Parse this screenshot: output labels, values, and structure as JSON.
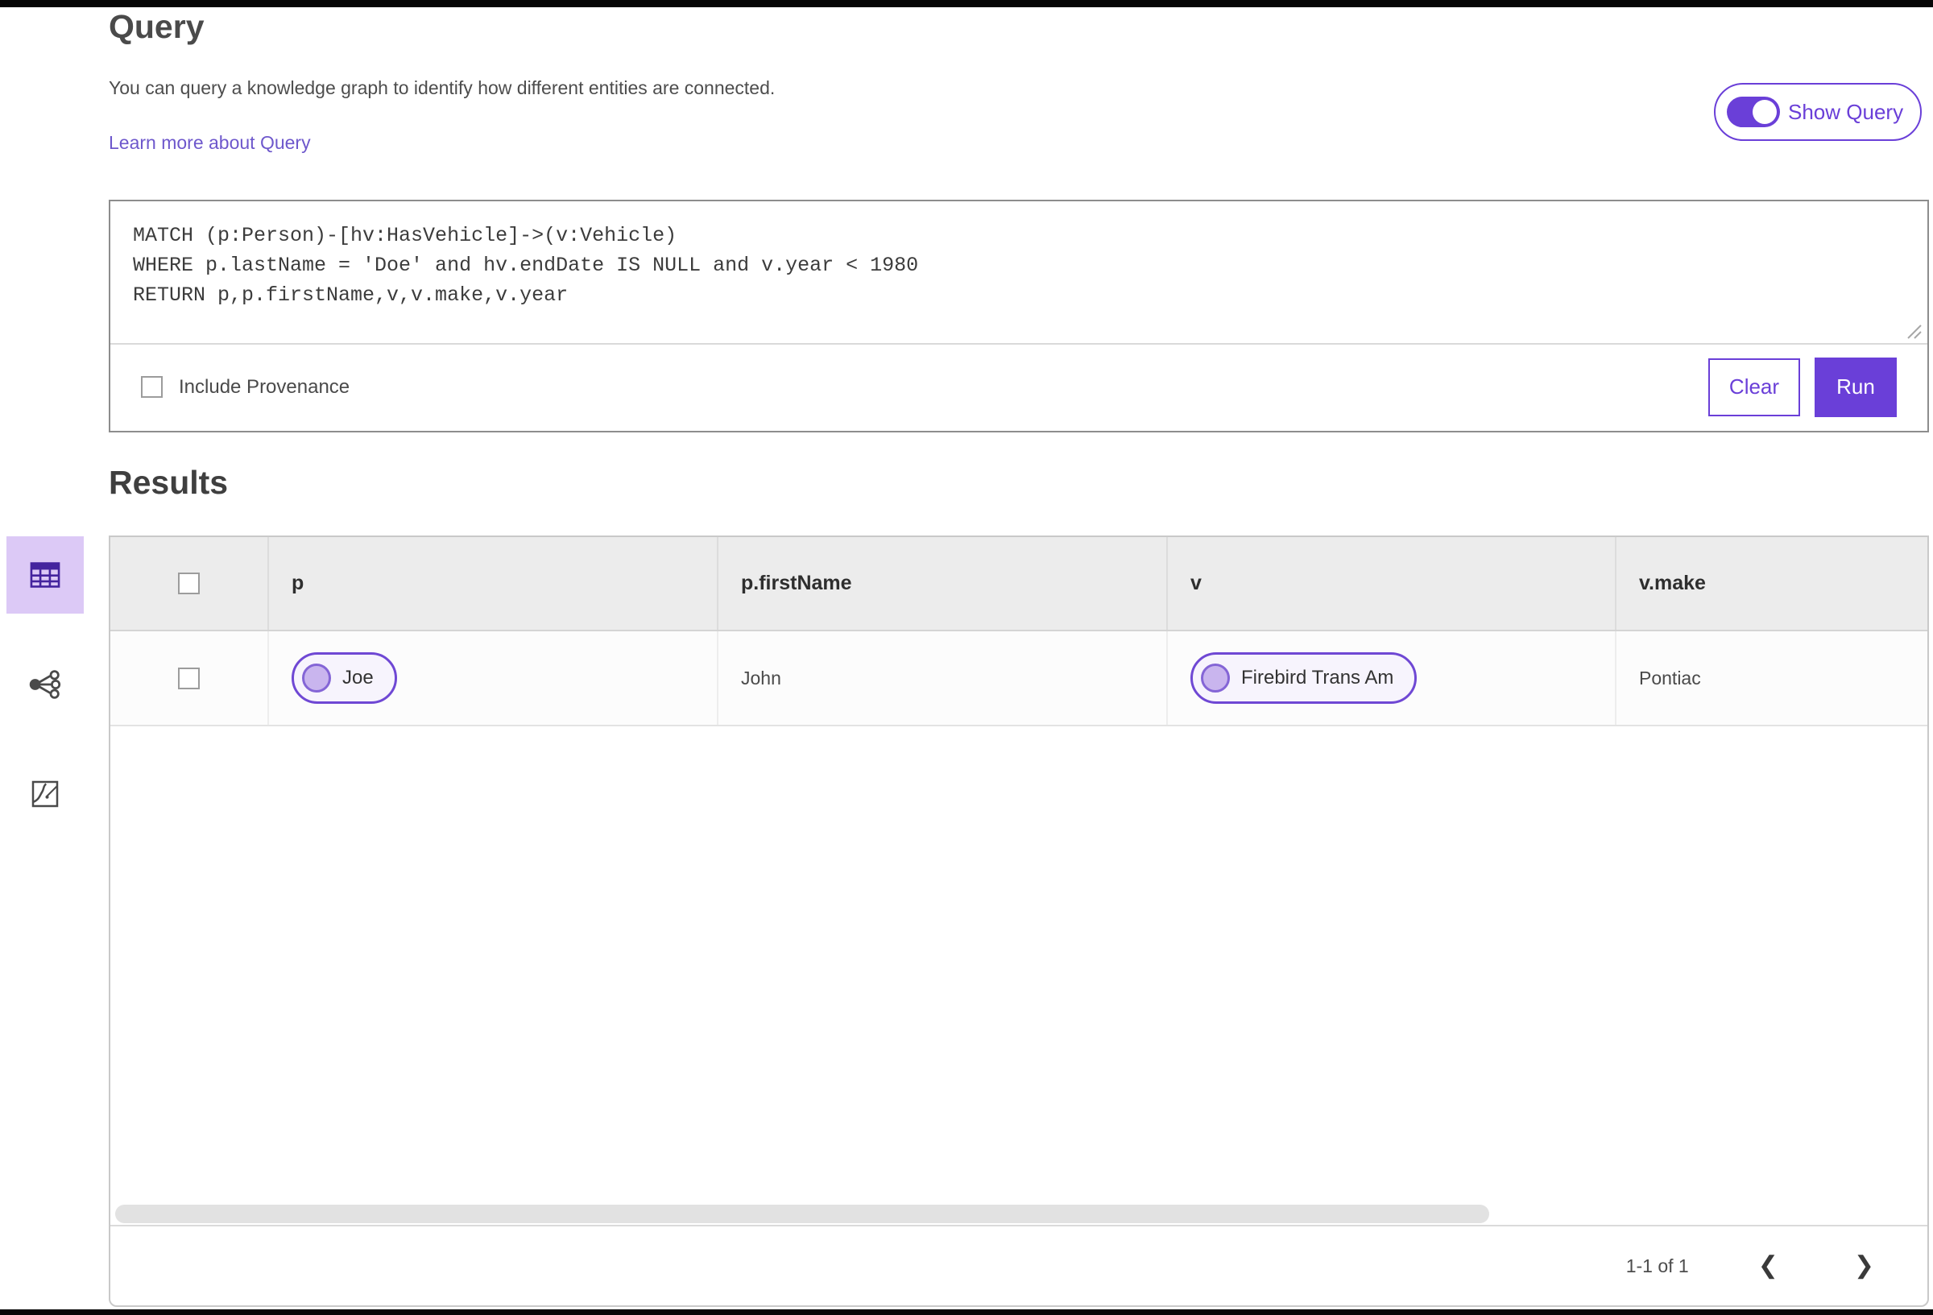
{
  "colors": {
    "accent_purple": "#6a3fd8",
    "link_purple": "#6e58cc",
    "selected_tile": "#dcc9f6",
    "chip_bg": "#f7f4fd",
    "chip_border": "#6f48d4",
    "table_header_bg": "#ececec"
  },
  "header": {
    "title": "Query",
    "description": "You can query a knowledge graph to identify how different entities are connected.",
    "learn_more": "Learn more about Query",
    "show_query_label": "Show Query",
    "show_query_on": true
  },
  "query_editor": {
    "code_lines": [
      "MATCH (p:Person)-[hv:HasVehicle]->(v:Vehicle)",
      "WHERE p.lastName = 'Doe' and hv.endDate IS NULL and v.year < 1980",
      "RETURN p,p.firstName,v,v.make,v.year"
    ],
    "include_provenance_label": "Include Provenance",
    "include_provenance_checked": false,
    "clear_label": "Clear",
    "run_label": "Run"
  },
  "results": {
    "title": "Results",
    "view_modes": [
      "table-view",
      "link-chart-view",
      "map-view"
    ],
    "selected_view": "table-view",
    "columns": [
      "p",
      "p.firstName",
      "v",
      "v.make"
    ],
    "rows": [
      {
        "p": "Joe",
        "first_name": "John",
        "v": "Firebird Trans Am",
        "make": "Pontiac"
      }
    ],
    "pagination": {
      "label": "1-1 of 1"
    }
  }
}
